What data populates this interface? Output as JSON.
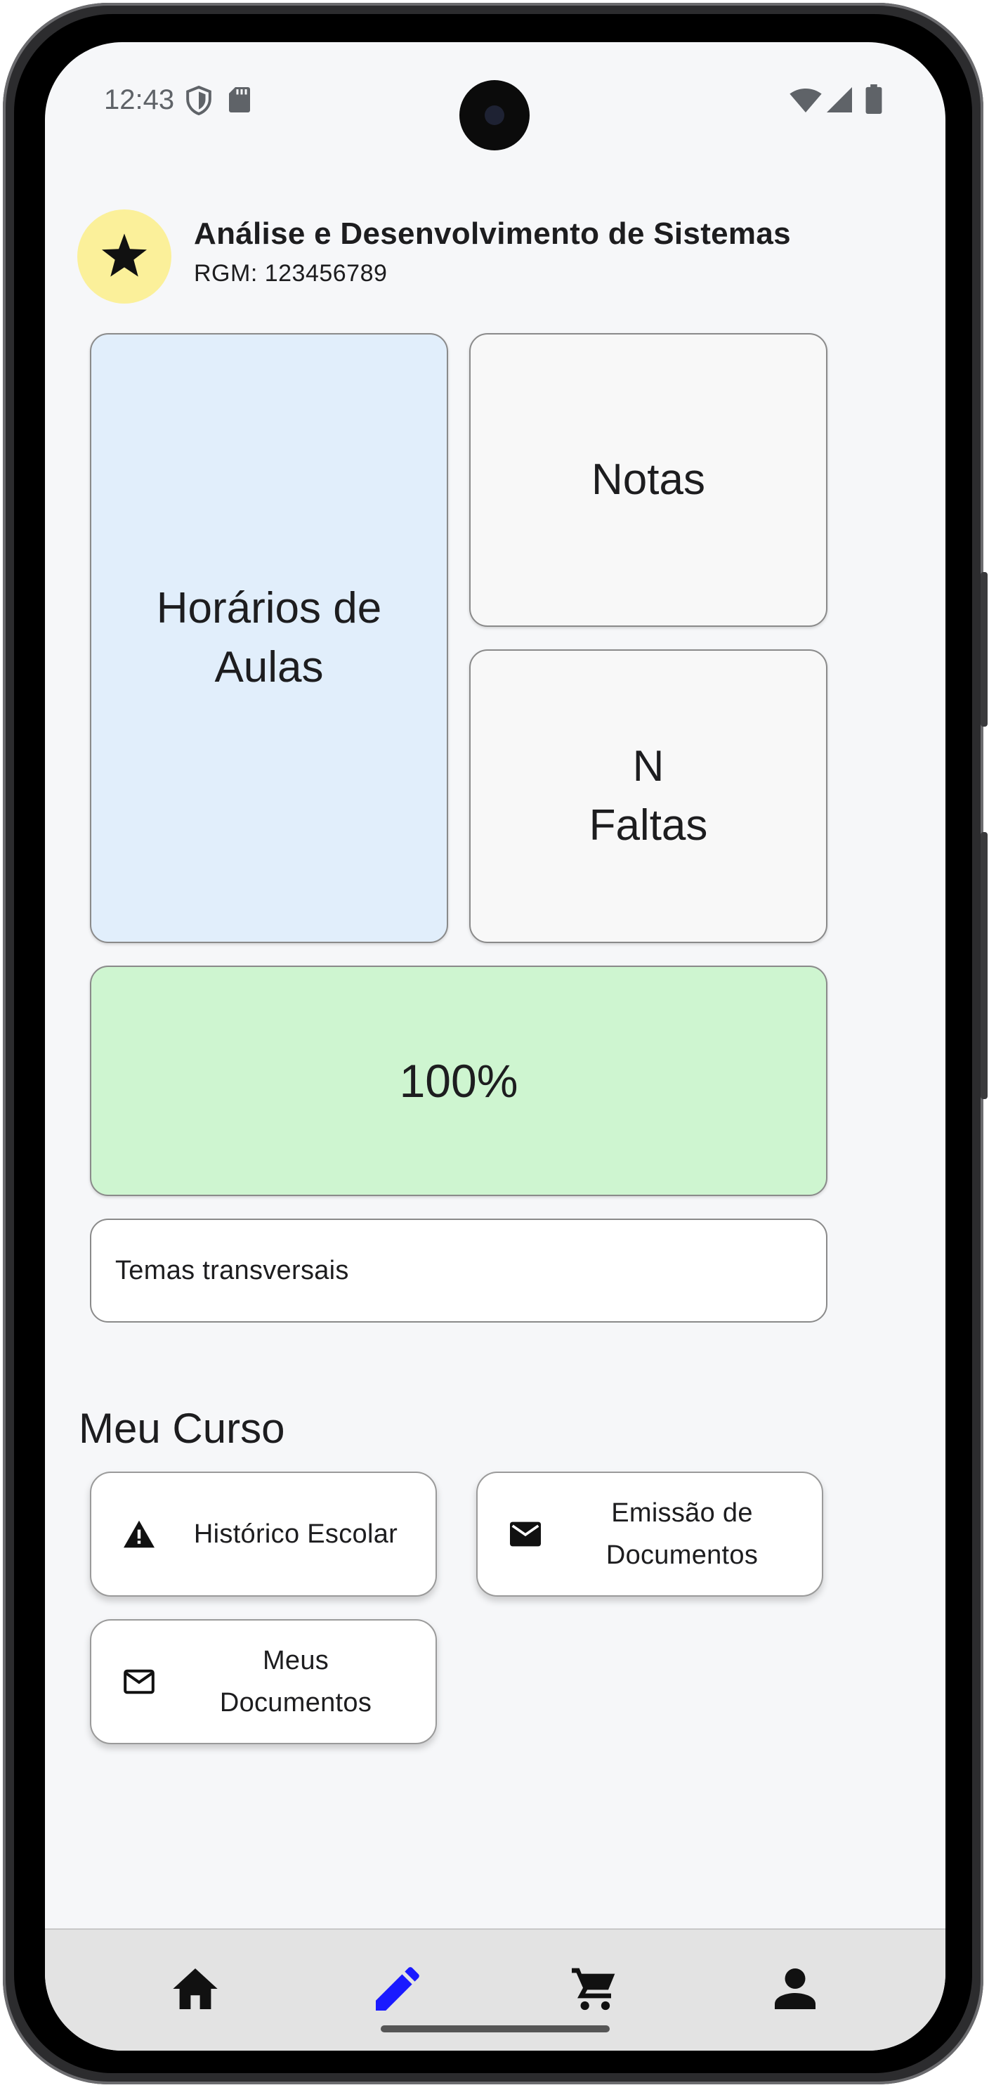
{
  "status_bar": {
    "time": "12:43",
    "left_icons": [
      "shield-icon",
      "sd-card-icon"
    ],
    "right_icons": [
      "wifi-icon",
      "signal-icon",
      "battery-icon"
    ]
  },
  "header": {
    "avatar_icon": "star-icon",
    "avatar_color": "#fbf09a",
    "course_title": "Análise e Desenvolvimento de Sistemas",
    "rgm": "RGM: 123456789"
  },
  "tiles": {
    "horarios": {
      "line1": "Horários de",
      "line2": "Aulas",
      "color": "#e1eefb"
    },
    "notas": {
      "label": "Notas",
      "color": "#f8f8f8"
    },
    "faltas": {
      "line1": "N",
      "line2": "Faltas",
      "color": "#f8f8f8"
    },
    "frequencia": {
      "label": "100%",
      "color": "#cef5d0"
    }
  },
  "temas": {
    "label": "Temas transversais"
  },
  "meu_curso": {
    "title": "Meu Curso",
    "buttons": [
      {
        "label": "Histórico Escolar",
        "icon": "warning-icon"
      },
      {
        "line1": "Emissão de",
        "line2": "Documentos",
        "icon": "mail-filled-icon"
      },
      {
        "line1": "Meus",
        "line2": "Documentos",
        "icon": "mail-outline-icon"
      }
    ]
  },
  "bottom_nav": {
    "items": [
      {
        "icon": "home-icon",
        "active": false
      },
      {
        "icon": "edit-icon",
        "active": true
      },
      {
        "icon": "cart-icon",
        "active": false
      },
      {
        "icon": "person-icon",
        "active": false
      }
    ],
    "active_color": "#1a1aff"
  }
}
